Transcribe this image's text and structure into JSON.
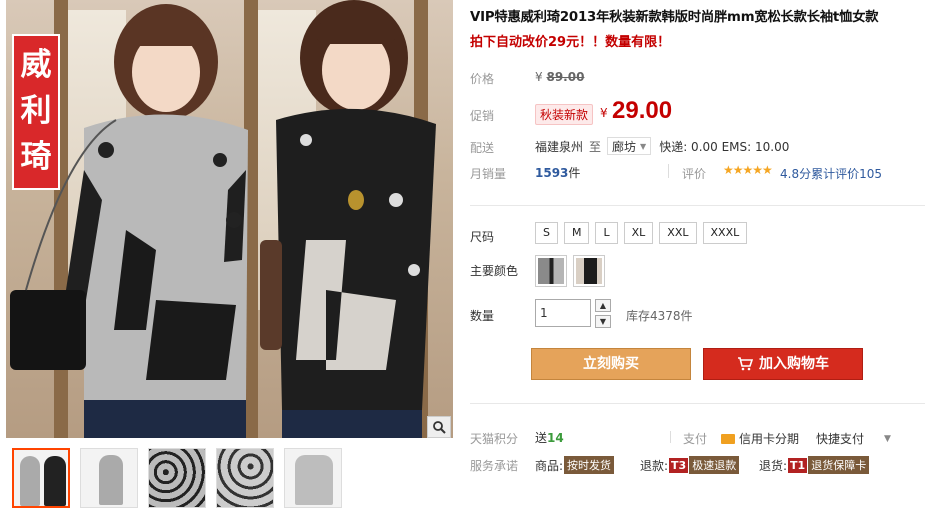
{
  "gallery": {
    "brand_chars": [
      "威",
      "利",
      "琦"
    ],
    "zoom_icon": "magnifier-icon",
    "thumbnails": 5
  },
  "product": {
    "title": "VIP特惠威利琦2013年秋装新款韩版时尚胖mm宽松长款长袖t恤女款",
    "subtitle": "拍下自动改价29元！！数量有限！"
  },
  "price": {
    "label": "价格",
    "currency": "¥",
    "original": "89.00",
    "promo_label": "促销",
    "promo_tag": "秋装新款",
    "promo_price": "29.00"
  },
  "shipping": {
    "label": "配送",
    "from": "福建泉州",
    "to_word": "至",
    "city": "廊坊",
    "fee": "快递: 0.00 EMS: 10.00"
  },
  "sales": {
    "label": "月销量",
    "count": "1593",
    "unit": "件",
    "rating_label": "评价",
    "stars": "★★★★★",
    "rating_text": "4.8分累计评价105"
  },
  "options": {
    "size_label": "尺码",
    "sizes": [
      "S",
      "M",
      "L",
      "XL",
      "XXL",
      "XXXL"
    ],
    "color_label": "主要颜色",
    "colors": [
      "#9a9a9a",
      "#1c1c1c"
    ],
    "qty_label": "数量",
    "qty_value": "1",
    "stock": "库存4378件"
  },
  "actions": {
    "buy_now": "立刻购买",
    "add_cart": "加入购物车"
  },
  "footer": {
    "points_label": "天猫积分",
    "points_prefix": "送",
    "points_value": "14",
    "pay_label": "支付",
    "card_pay": "信用卡分期",
    "quick_pay": "快捷支付",
    "service_label": "服务承诺",
    "svc1_key": "商品:",
    "svc1_tag": "按时发货",
    "svc2_key": "退款:",
    "svc2_badge": "T3",
    "svc2_tag": "极速退款",
    "svc3_key": "退货:",
    "svc3_badge": "T1",
    "svc3_tag": "退货保障卡"
  }
}
